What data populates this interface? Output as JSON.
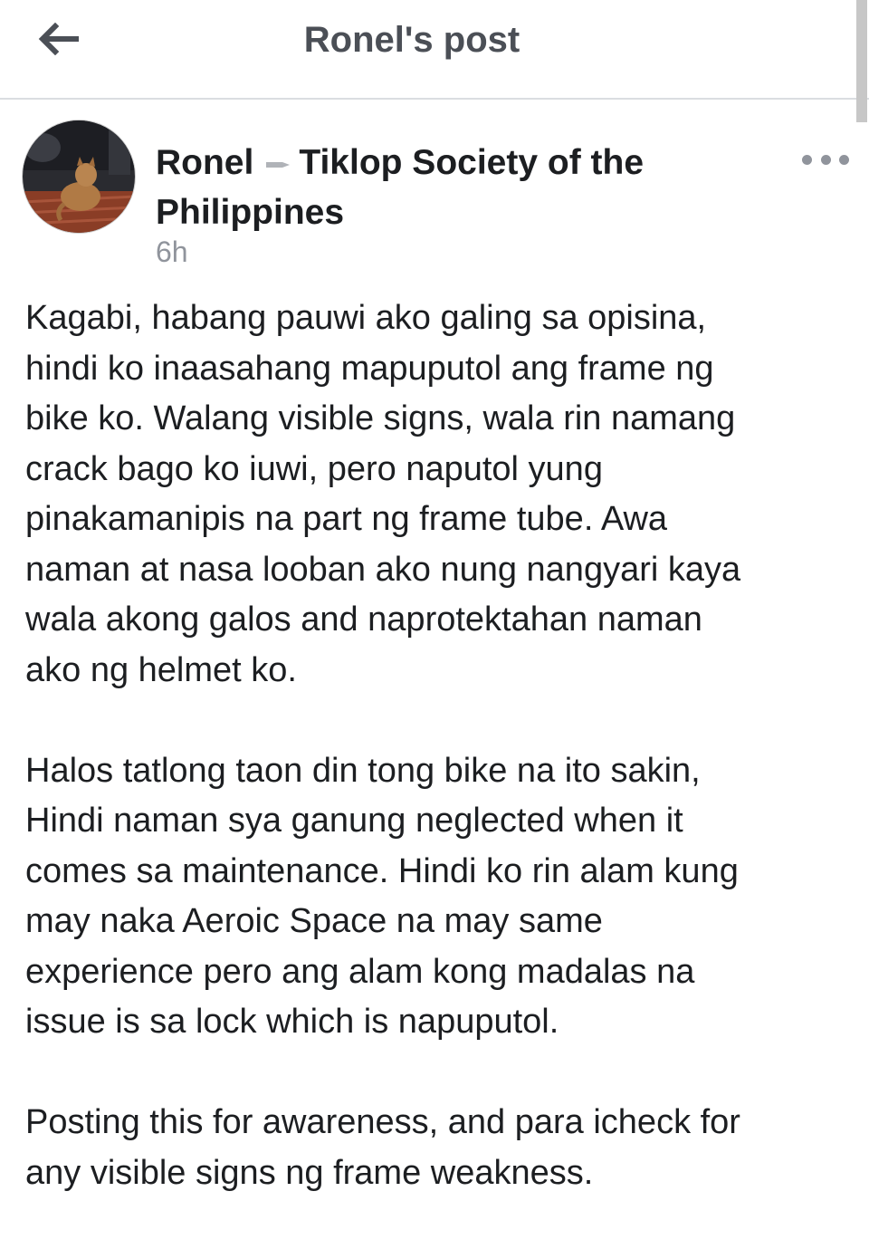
{
  "header": {
    "title": "Ronel's post",
    "back_icon": "back-arrow-icon"
  },
  "post": {
    "author": "Ronel",
    "separator_icon": "triangle-right-icon",
    "group": "Tiklop Society of the Philippines",
    "timestamp": "6h",
    "more_icon": "more-options-icon",
    "paragraphs": [
      "Kagabi, habang pauwi ako galing sa opisina,\nhindi ko inaasahang mapuputol ang frame ng\nbike ko. Walang visible signs, wala rin namang\ncrack bago ko iuwi, pero naputol yung\npinakamanipis na part ng frame tube. Awa\nnaman at nasa looban ako nung nangyari kaya\nwala akong galos and naprotektahan naman\nako ng helmet ko.",
      "Halos tatlong taon din tong bike na ito sakin,\nHindi naman sya ganung neglected when it\ncomes sa maintenance. Hindi ko rin alam kung\nmay naka Aeroic Space na may same\nexperience pero ang alam kong madalas na\nissue is sa lock which is napuputol.",
      "Posting this for awareness, and para icheck for\nany visible signs ng frame weakness."
    ]
  }
}
